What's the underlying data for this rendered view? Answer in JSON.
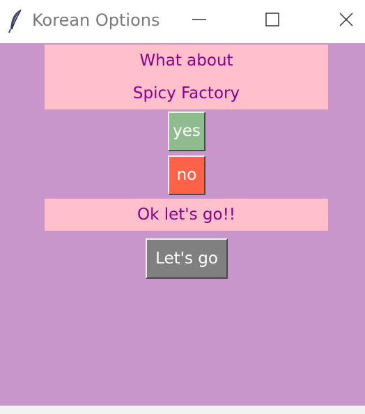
{
  "window": {
    "title": "Korean Options",
    "icon": "feather-icon",
    "controls": [
      "minimize-icon",
      "maximize-icon",
      "close-icon"
    ]
  },
  "question": {
    "line1": "What about",
    "line2": "Spicy Factory"
  },
  "buttons": {
    "yes_label": "yes",
    "no_label": "no",
    "go_label": "Let's go"
  },
  "answer": {
    "text": "Ok let's go!!"
  },
  "colors": {
    "background": "#c996cc",
    "label_bg": "#ffc0cb",
    "label_text": "#8b008b",
    "yes_bg": "#8fbc8f",
    "no_bg": "#ff6347",
    "go_bg": "#808080"
  }
}
